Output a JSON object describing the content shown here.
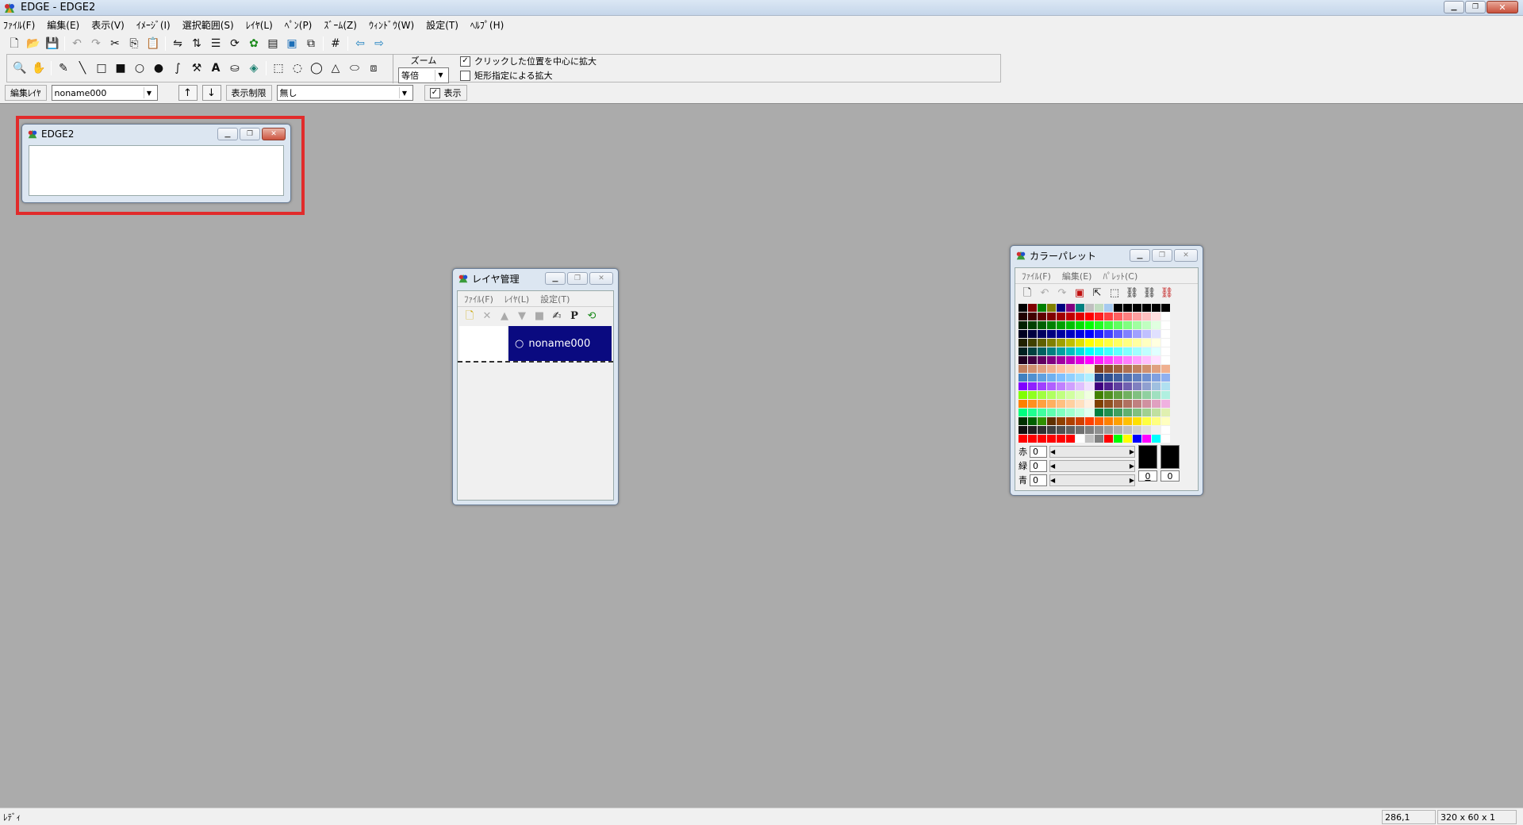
{
  "app": {
    "title": "EDGE - EDGE2"
  },
  "menubar": [
    "ﾌｧｲﾙ(F)",
    "編集(E)",
    "表示(V)",
    "ｲﾒｰｼﾞ(I)",
    "選択範囲(S)",
    "ﾚｲﾔ(L)",
    "ﾍﾟﾝ(P)",
    "ｽﾞｰﾑ(Z)",
    "ｳｨﾝﾄﾞｳ(W)",
    "設定(T)",
    "ﾍﾙﾌﾟ(H)"
  ],
  "toolbar2": {
    "zoom_label": "ズーム",
    "zoom_value": "等倍",
    "opt_center": "クリックした位置を中心に拡大",
    "opt_rect": "矩形指定による拡大"
  },
  "layerbar": {
    "edit_layer_label": "編集ﾚｲﾔ",
    "edit_layer_value": "noname000",
    "up_arrow": "↑",
    "down_arrow": "↓",
    "display_limit_label": "表示制限",
    "display_limit_value": "無し",
    "show_label": "表示"
  },
  "edge2_window": {
    "title": "EDGE2"
  },
  "layer_window": {
    "title": "レイヤ管理",
    "menu": [
      "ﾌｧｲﾙ(F)",
      "ﾚｲﾔ(L)",
      "設定(T)"
    ],
    "layer_name": "noname000"
  },
  "palette_window": {
    "title": "カラーパレット",
    "menu": [
      "ﾌｧｲﾙ(F)",
      "編集(E)",
      "ﾊﾟﾚｯﾄ(C)"
    ],
    "red_label": "赤",
    "green_label": "緑",
    "blue_label": "青",
    "red_value": "0",
    "green_value": "0",
    "blue_value": "0",
    "index_a": "0",
    "index_b": "0",
    "colors": [
      "#000000",
      "#800000",
      "#008000",
      "#808000",
      "#000080",
      "#800080",
      "#008080",
      "#c0c0c0",
      "#c0dcc0",
      "#a6caf0",
      "#000000",
      "#000000",
      "#000000",
      "#000000",
      "#000000",
      "#000000",
      "#200000",
      "#400000",
      "#600000",
      "#800000",
      "#a00000",
      "#c00000",
      "#e00000",
      "#ff0000",
      "#ff2020",
      "#ff4040",
      "#ff6060",
      "#ff8080",
      "#ffa0a0",
      "#ffc0c0",
      "#ffe0e0",
      "#ffffff",
      "#002000",
      "#004000",
      "#006000",
      "#008000",
      "#00a000",
      "#00c000",
      "#00e000",
      "#00ff00",
      "#20ff20",
      "#40ff40",
      "#60ff60",
      "#80ff80",
      "#a0ffa0",
      "#c0ffc0",
      "#e0ffe0",
      "#ffffff",
      "#000020",
      "#000040",
      "#000060",
      "#000080",
      "#0000a0",
      "#0000c0",
      "#0000e0",
      "#0000ff",
      "#2020ff",
      "#4040ff",
      "#6060ff",
      "#8080ff",
      "#a0a0ff",
      "#c0c0ff",
      "#e0e0ff",
      "#ffffff",
      "#202000",
      "#404000",
      "#606000",
      "#808000",
      "#a0a000",
      "#c0c000",
      "#e0e000",
      "#ffff00",
      "#ffff20",
      "#ffff40",
      "#ffff60",
      "#ffff80",
      "#ffffa0",
      "#ffffc0",
      "#ffffe0",
      "#ffffff",
      "#002020",
      "#004040",
      "#006060",
      "#008080",
      "#00a0a0",
      "#00c0c0",
      "#00e0e0",
      "#00ffff",
      "#20ffff",
      "#40ffff",
      "#60ffff",
      "#80ffff",
      "#a0ffff",
      "#c0ffff",
      "#e0ffff",
      "#ffffff",
      "#200020",
      "#400040",
      "#600060",
      "#800080",
      "#a000a0",
      "#c000c0",
      "#e000e0",
      "#ff00ff",
      "#ff20ff",
      "#ff40ff",
      "#ff60ff",
      "#ff80ff",
      "#ffa0ff",
      "#ffc0ff",
      "#ffe0ff",
      "#ffffff",
      "#c08060",
      "#d09070",
      "#e0a080",
      "#f0b090",
      "#ffc0a0",
      "#ffd0b0",
      "#ffe0c0",
      "#fff0d0",
      "#804020",
      "#905030",
      "#a06040",
      "#b07050",
      "#c08060",
      "#d09070",
      "#e0a080",
      "#f0b090",
      "#4080c0",
      "#5090d0",
      "#60a0e0",
      "#70b0f0",
      "#80c0ff",
      "#90d0ff",
      "#a0e0ff",
      "#b0f0ff",
      "#204080",
      "#305090",
      "#4060a0",
      "#5070b0",
      "#6080c0",
      "#7090d0",
      "#80a0e0",
      "#90b0f0",
      "#8000ff",
      "#9020ff",
      "#a040ff",
      "#b060ff",
      "#c080ff",
      "#d0a0ff",
      "#e0c0ff",
      "#f0e0ff",
      "#400080",
      "#502090",
      "#6040a0",
      "#7060b0",
      "#8080c0",
      "#90a0d0",
      "#a0c0e0",
      "#b0e0f0",
      "#80ff00",
      "#90ff20",
      "#a0ff40",
      "#b0ff60",
      "#c0ff80",
      "#d0ffa0",
      "#e0ffc0",
      "#f0ffe0",
      "#408000",
      "#509020",
      "#60a040",
      "#70b060",
      "#80c080",
      "#90d0a0",
      "#a0e0c0",
      "#b0f0e0",
      "#ff8000",
      "#ff9020",
      "#ffa040",
      "#ffb060",
      "#ffc080",
      "#ffd0a0",
      "#ffe0c0",
      "#fff0e0",
      "#804000",
      "#905020",
      "#a06040",
      "#b07060",
      "#c08080",
      "#d090a0",
      "#e0a0c0",
      "#f0b0e0",
      "#00ff80",
      "#20ff90",
      "#40ffa0",
      "#60ffb0",
      "#80ffc0",
      "#a0ffd0",
      "#c0ffe0",
      "#e0fff0",
      "#008040",
      "#209050",
      "#40a060",
      "#60b070",
      "#80c080",
      "#a0d090",
      "#c0e0a0",
      "#e0f0b0",
      "#003000",
      "#006000",
      "#309000",
      "#603000",
      "#904000",
      "#b04000",
      "#d04000",
      "#ff4000",
      "#ff6000",
      "#ff8000",
      "#ffa000",
      "#ffc000",
      "#ffe000",
      "#ffff40",
      "#ffff80",
      "#ffffc0",
      "#101010",
      "#202020",
      "#303030",
      "#404040",
      "#505050",
      "#606060",
      "#707070",
      "#808080",
      "#909090",
      "#a0a0a0",
      "#b0b0b0",
      "#c0c0c0",
      "#d0d0d0",
      "#e0e0e0",
      "#f0f0f0",
      "#ffffff",
      "#ff0000",
      "#ff0000",
      "#ff0000",
      "#ff0000",
      "#ff0000",
      "#ff0000",
      "#ffffff",
      "#c0c0c0",
      "#808080",
      "#ff0000",
      "#00ff00",
      "#ffff00",
      "#0000ff",
      "#ff00ff",
      "#00ffff",
      "#ffffff"
    ]
  },
  "statusbar": {
    "text": "ﾚﾃﾞｨ",
    "coords": "286,1",
    "size": "320 x 60 x 1"
  }
}
